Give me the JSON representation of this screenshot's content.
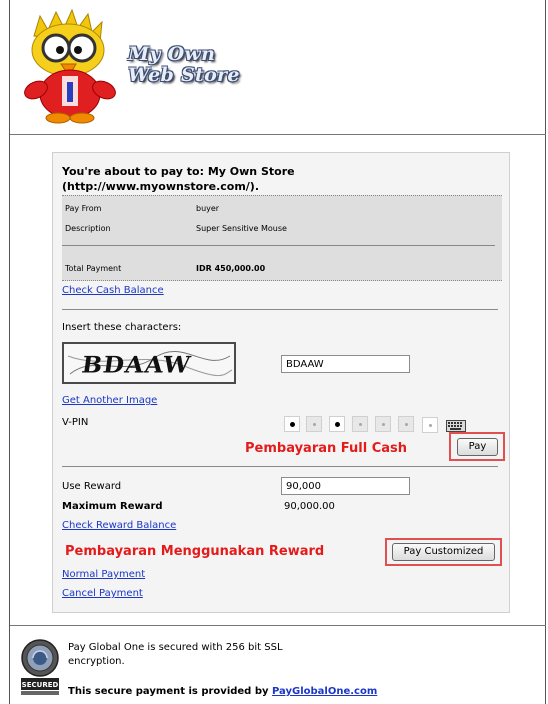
{
  "store": {
    "title_line1": "My Own",
    "title_line2": "Web Store"
  },
  "payment": {
    "title": "You're about to pay to: My Own Store (http://www.myownstore.com/).",
    "pay_from_label": "Pay From",
    "pay_from_value": "buyer",
    "description_label": "Description",
    "description_value": "Super Sensitive Mouse",
    "total_label": "Total Payment",
    "total_value": "IDR 450,000.00"
  },
  "links": {
    "check_cash_balance": "Check Cash Balance",
    "get_another_image": "Get Another Image",
    "check_reward_balance": "Check Reward Balance",
    "normal_payment": "Normal Payment",
    "cancel_payment": "Cancel Payment"
  },
  "captcha": {
    "instruction": "Insert these characters:",
    "image_text": "BDAAW",
    "input_value": "BDAAW"
  },
  "vpin": {
    "label": "V-PIN",
    "boxes": [
      "filled",
      "empty",
      "filled",
      "empty",
      "empty",
      "empty"
    ],
    "keyboard_icon": "keyboard-icon"
  },
  "full_cash": {
    "annotation": "Pembayaran Full Cash",
    "button_label": "Pay"
  },
  "reward": {
    "use_label": "Use Reward",
    "use_value": "90,000",
    "max_label": "Maximum Reward",
    "max_value": "90,000.00",
    "annotation": "Pembayaran Menggunakan Reward",
    "button_label": "Pay Customized"
  },
  "footer": {
    "secured_text": "Pay Global One is secured with 256 bit SSL encryption.",
    "provided_text": "This secure payment is provided by ",
    "provided_link": "PayGlobalOne.com",
    "badge_text": "SECURED"
  },
  "colors": {
    "annotation_red": "#e41b1b",
    "link_blue": "#1a37c7",
    "panel_bg": "#f4f4f4"
  }
}
